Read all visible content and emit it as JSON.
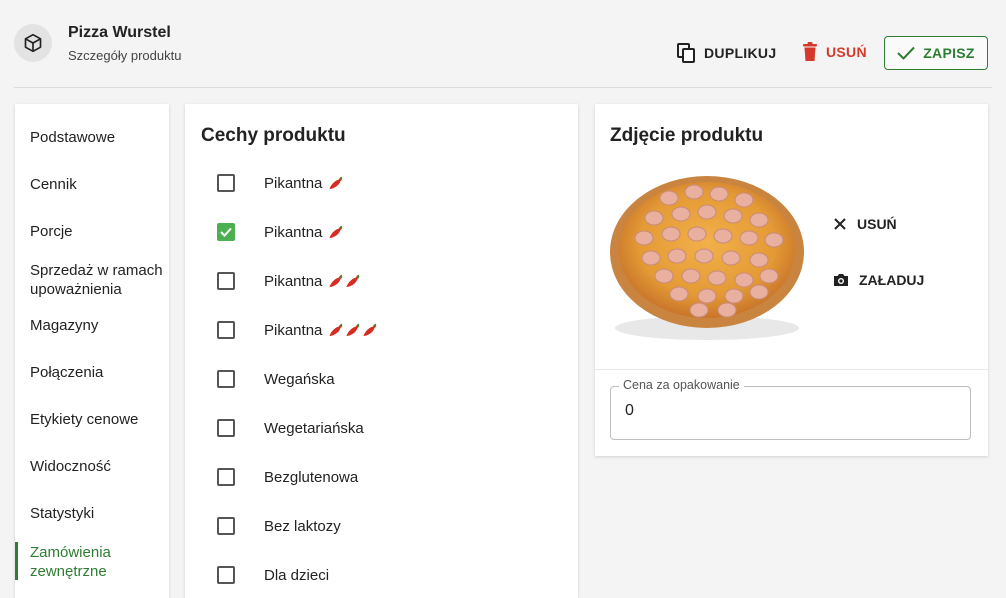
{
  "header": {
    "title": "Pizza Wurstel",
    "subtitle": "Szczegóły produktu",
    "actions": {
      "duplicate_label": "DUPLIKUJ",
      "delete_label": "USUŃ",
      "save_label": "ZAPISZ"
    }
  },
  "sidebar": {
    "items": [
      {
        "label": "Podstawowe"
      },
      {
        "label": "Cennik"
      },
      {
        "label": "Porcje"
      },
      {
        "label": "Sprzedaż w ramach upoważnienia"
      },
      {
        "label": "Magazyny"
      },
      {
        "label": "Połączenia"
      },
      {
        "label": "Etykiety cenowe"
      },
      {
        "label": "Widoczność"
      },
      {
        "label": "Statystyki"
      },
      {
        "label": "Zamówienia zewnętrzne",
        "active": true
      }
    ]
  },
  "features": {
    "title": "Cechy produktu",
    "items": [
      {
        "label": "Pikantna",
        "peppers": 1,
        "checked": false
      },
      {
        "label": "Pikantna",
        "peppers": 1,
        "checked": true
      },
      {
        "label": "Pikantna",
        "peppers": 2,
        "checked": false
      },
      {
        "label": "Pikantna",
        "peppers": 3,
        "checked": false
      },
      {
        "label": "Wegańska",
        "peppers": 0,
        "checked": false
      },
      {
        "label": "Wegetariańska",
        "peppers": 0,
        "checked": false
      },
      {
        "label": "Bezglutenowa",
        "peppers": 0,
        "checked": false
      },
      {
        "label": "Bez laktozy",
        "peppers": 0,
        "checked": false
      },
      {
        "label": "Dla dzieci",
        "peppers": 0,
        "checked": false
      }
    ]
  },
  "photo": {
    "title": "Zdjęcie produktu",
    "remove_label": "USUŃ",
    "upload_label": "ZAŁADUJ",
    "package_price": {
      "label": "Cena za opakowanie",
      "value": "0"
    }
  },
  "colors": {
    "accent": "#2e7d32",
    "danger": "#d33a2c",
    "checkbox_checked": "#4caf50"
  }
}
